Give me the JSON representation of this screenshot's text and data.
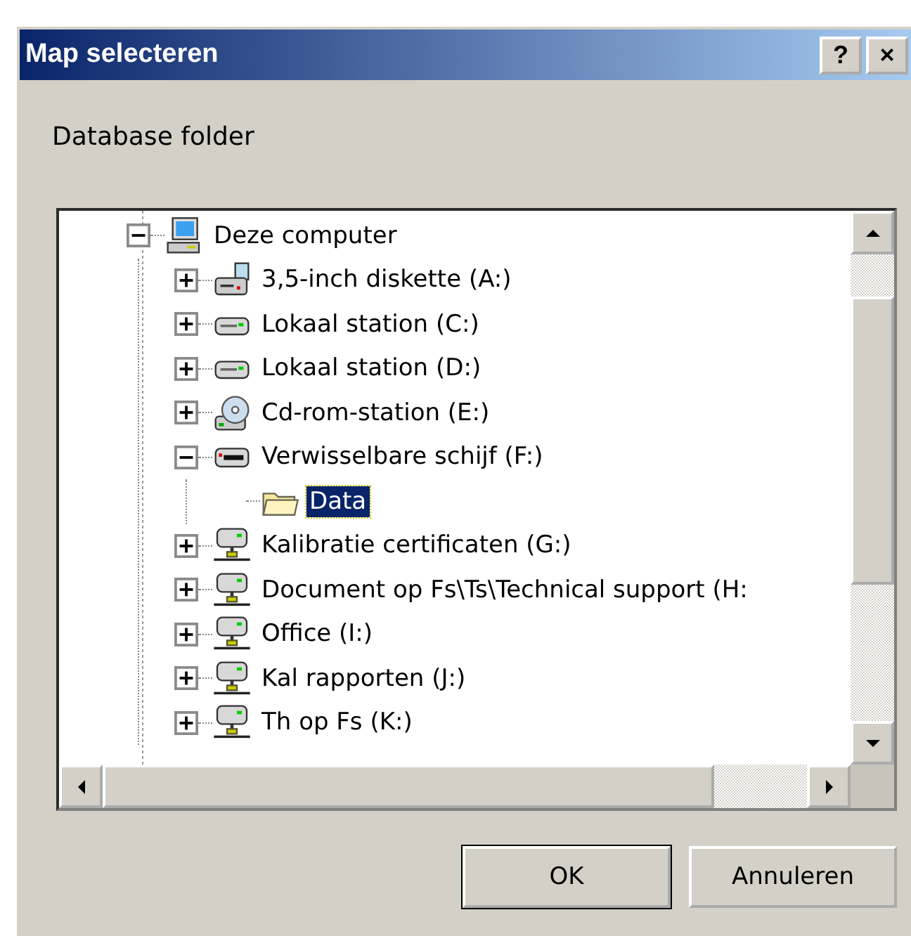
{
  "window": {
    "title": "Map selecteren",
    "title_buttons": [
      "?",
      "×"
    ]
  },
  "prompt": "Database folder",
  "tree": [
    {
      "label": "Deze computer",
      "kind": "computer",
      "expanded": true,
      "selected": false,
      "children": [
        {
          "label": "3,5-inch diskette (A:)",
          "kind": "floppy",
          "expanded": false,
          "selected": false
        },
        {
          "label": "Lokaal station (C:)",
          "kind": "disk",
          "expanded": false,
          "selected": false
        },
        {
          "label": "Lokaal station (D:)",
          "kind": "disk",
          "expanded": false,
          "selected": false
        },
        {
          "label": "Cd-rom-station (E:)",
          "kind": "cdrom",
          "expanded": false,
          "selected": false
        },
        {
          "label": "Verwisselbare schijf (F:)",
          "kind": "removable",
          "expanded": true,
          "selected": false,
          "children": [
            {
              "label": "Data",
              "kind": "folder",
              "selected": true
            }
          ]
        },
        {
          "label": "Kalibratie certificaten (G:)",
          "kind": "network",
          "expanded": false,
          "selected": false
        },
        {
          "label": "Document op Fs\\Ts\\Technical support (H:",
          "kind": "network",
          "expanded": false,
          "selected": false
        },
        {
          "label": "Office (I:)",
          "kind": "network",
          "expanded": false,
          "selected": false
        },
        {
          "label": "Kal rapporten (J:)",
          "kind": "network",
          "expanded": false,
          "selected": false
        },
        {
          "label": "Th op Fs (K:)",
          "kind": "network",
          "expanded": false,
          "selected": false
        }
      ]
    }
  ],
  "buttons": [
    "OK",
    "Annuleren"
  ]
}
